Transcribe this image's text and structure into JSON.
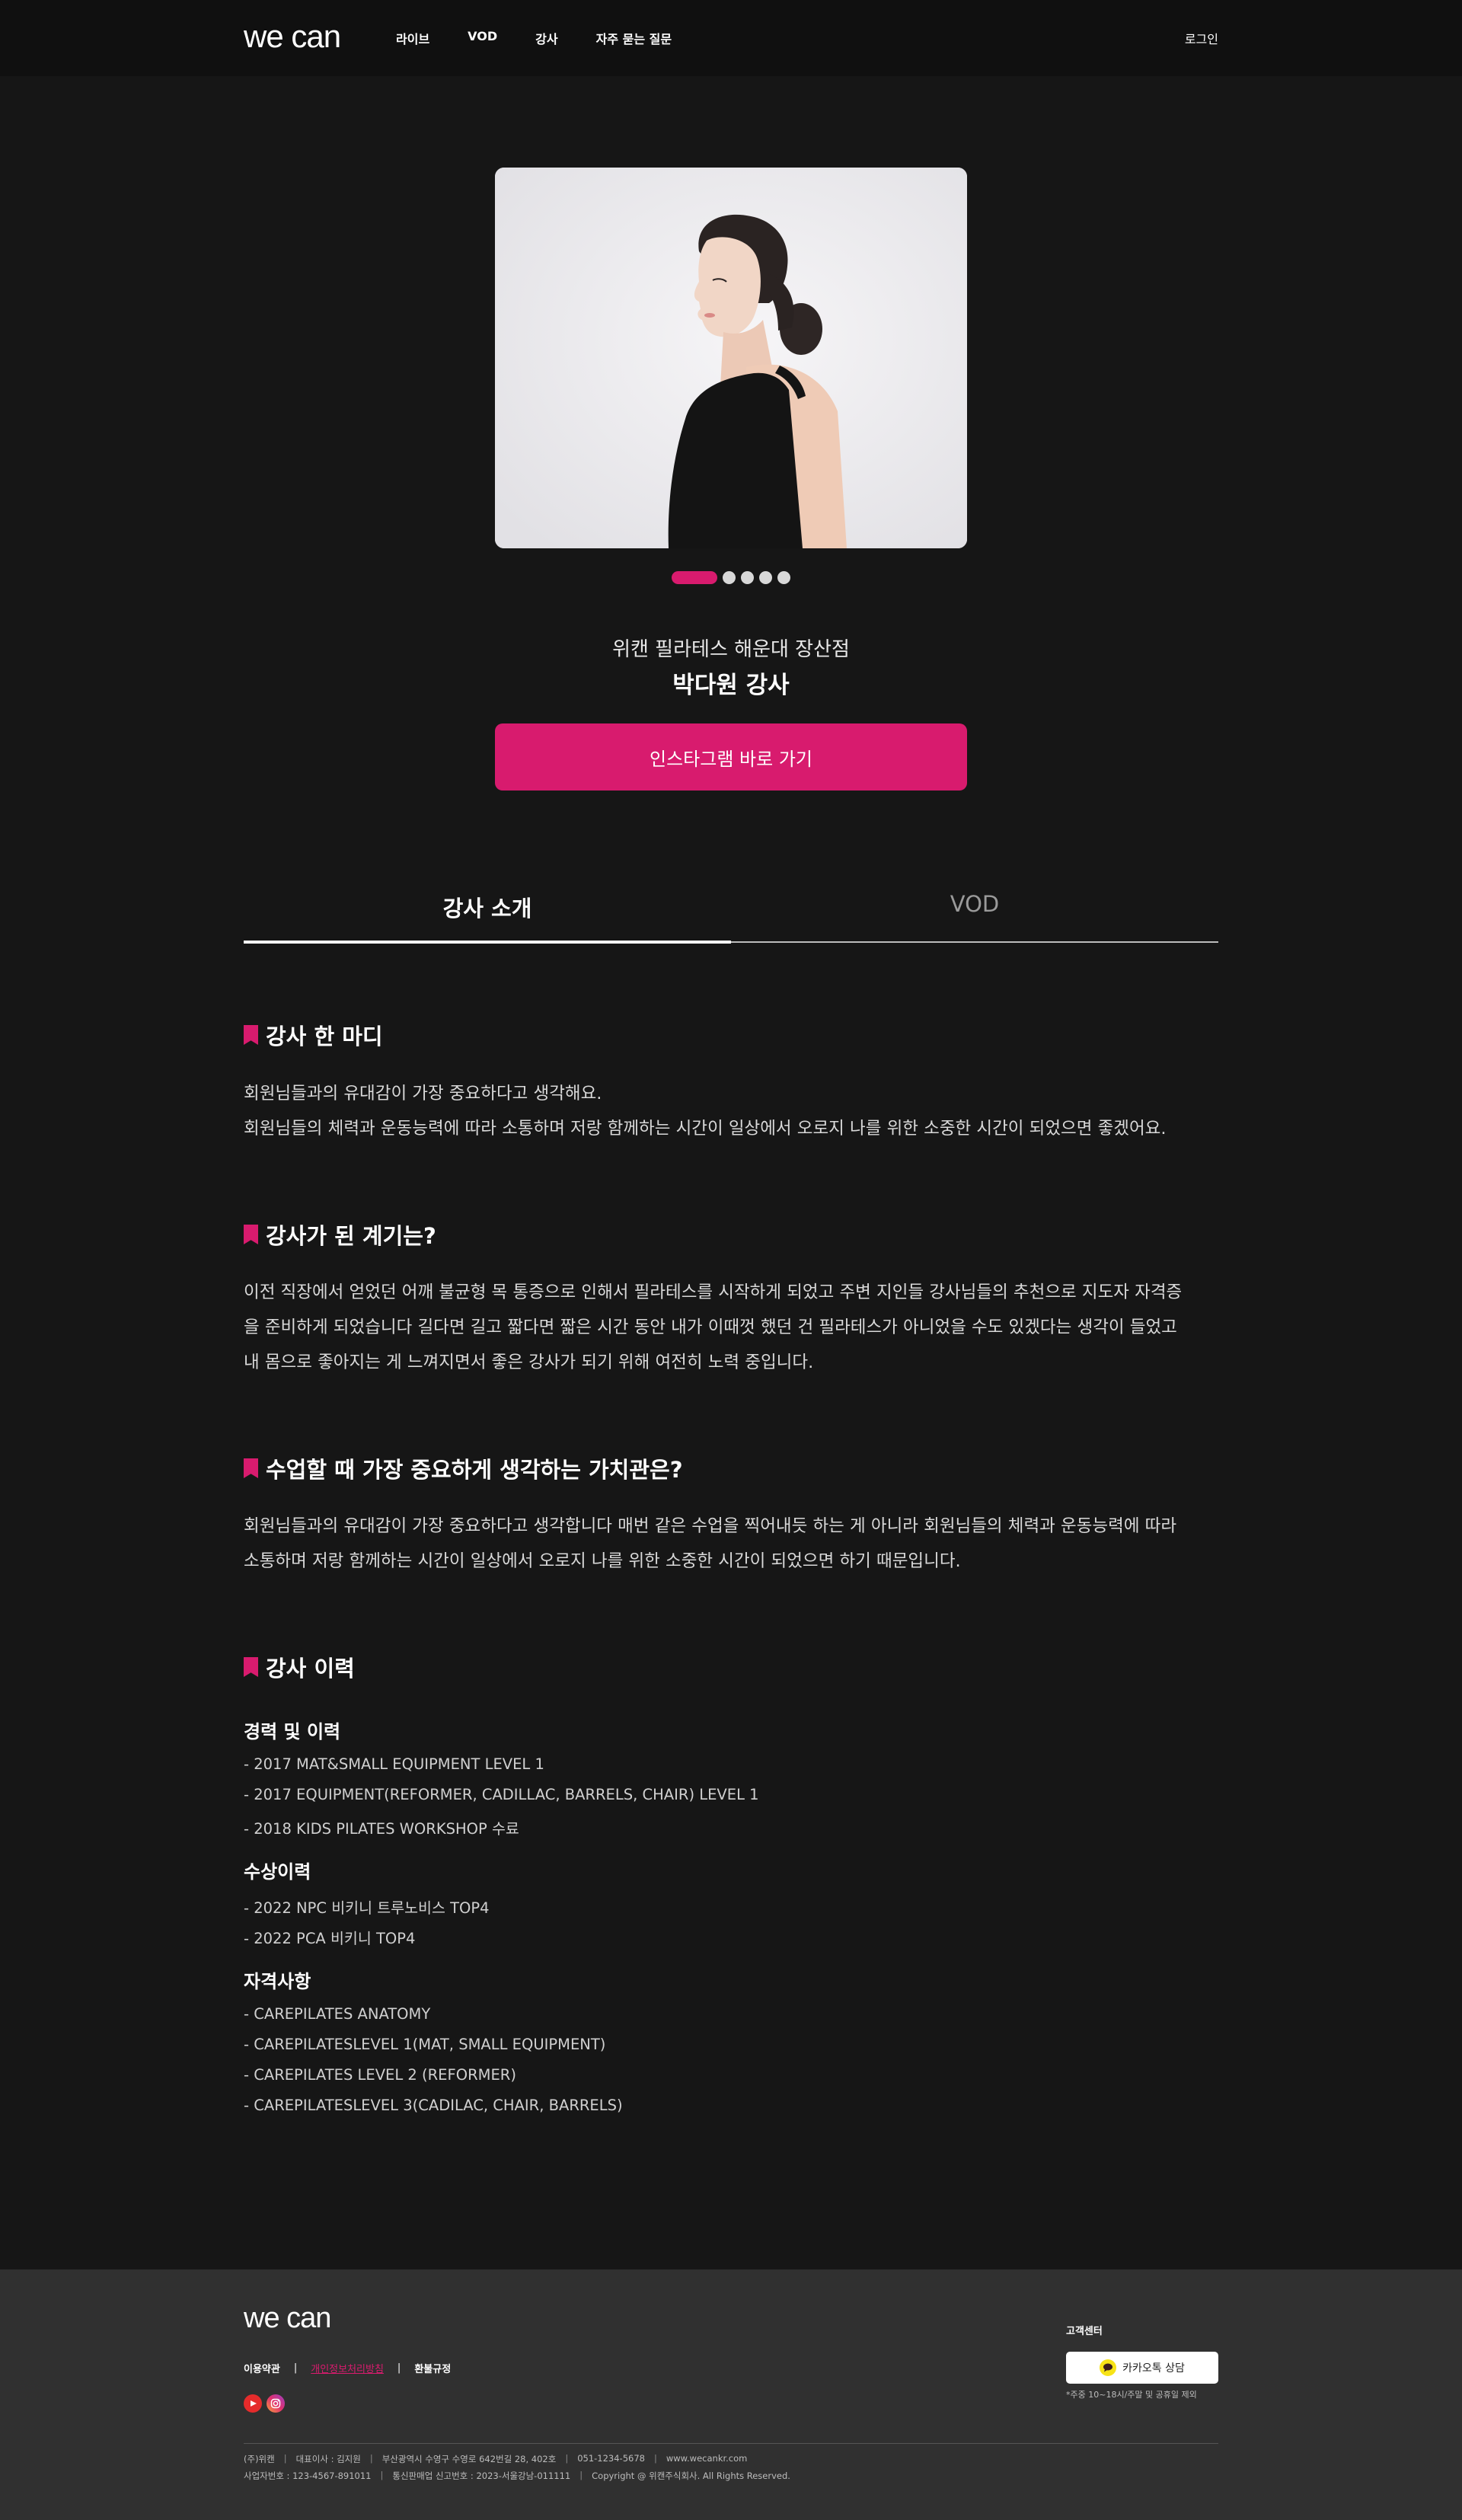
{
  "header": {
    "logo": "we can",
    "nav": [
      "라이브",
      "VOD",
      "강사",
      "자주 묻는 질문"
    ],
    "login": "로그인"
  },
  "profile": {
    "slides_total": 5,
    "active_slide": 1,
    "studio": "위캔 필라테스 해운대 장산점",
    "instructor": "박다원 강사",
    "instagram_button": "인스타그램 바로 가기"
  },
  "tabs": [
    "강사 소개",
    "VOD"
  ],
  "sections": {
    "one_word": {
      "title": "강사 한 마디",
      "lines": [
        "회원님들과의 유대감이 가장 중요하다고 생각해요.",
        "회원님들의 체력과 운동능력에 따라 소통하며 저랑 함께하는 시간이 일상에서 오로지 나를 위한 소중한 시간이 되었으면 좋겠어요."
      ]
    },
    "motivation": {
      "title": "강사가 된 계기는?",
      "lines": [
        "이전 직장에서 얻었던 어깨 불균형 목 통증으로 인해서 필라테스를 시작하게 되었고 주변 지인들 강사님들의 추천으로 지도자 자격증",
        "을 준비하게 되었습니다 길다면 길고 짧다면 짧은 시간 동안 내가 이때껏 했던 건 필라테스가 아니었을 수도 있겠다는 생각이 들었고",
        "내 몸으로 좋아지는 게 느껴지면서 좋은 강사가 되기 위해 여전히 노력 중입니다."
      ]
    },
    "values": {
      "title": "수업할 때 가장 중요하게 생각하는 가치관은?",
      "lines": [
        "회원님들과의 유대감이 가장 중요하다고 생각합니다 매번 같은 수업을 찍어내듯 하는 게 아니라 회원님들의 체력과 운동능력에 따라",
        "소통하며 저랑 함께하는 시간이 일상에서 오로지 나를 위한 소중한 시간이 되었으면 하기 때문입니다."
      ]
    },
    "history": {
      "title": "강사 이력",
      "career_title": "경력 및 이력",
      "career": [
        "- 2017 MAT&SMALL EQUIPMENT LEVEL 1",
        "- 2017 EQUIPMENT(REFORMER, CADILLAC, BARRELS, CHAIR) LEVEL 1",
        "- 2018 KIDS PILATES WORKSHOP 수료"
      ],
      "awards_title": "수상이력",
      "awards": [
        "- 2022 NPC 비키니 트루노비스 TOP4",
        "- 2022 PCA 비키니 TOP4"
      ],
      "certs_title": "자격사항",
      "certs": [
        "- CAREPILATES ANATOMY",
        "- CAREPILATESLEVEL 1(MAT, SMALL EQUIPMENT)",
        "- CAREPILATES LEVEL 2 (REFORMER)",
        "- CAREPILATESLEVEL 3(CADILAC, CHAIR, BARRELS)"
      ]
    }
  },
  "footer": {
    "logo": "we can",
    "links": [
      "이용약관",
      "개인정보처리방침",
      "환불규정"
    ],
    "cs_title": "고객센터",
    "kakao_button": "카카오톡 상담",
    "cs_note": "*주중 10~18시/주말 및 공휴일 제외",
    "info1": [
      "(주)위캔",
      "대표이사 : 김지원",
      "부산광역시 수영구 수영로 642번길 28, 402호",
      "051-1234-5678",
      "www.wecankr.com"
    ],
    "info2": [
      "사업자번호 : 123-4567-891011",
      "통신판매업 신고번호 : 2023-서울강남-011111",
      "Copyright @ 위캔주식회사. All Rights Reserved."
    ]
  },
  "colors": {
    "accent": "#d81b6e",
    "background": "#161616",
    "header": "#101010",
    "footer": "#303030"
  },
  "icons": [
    "youtube-icon",
    "instagram-icon",
    "kakaotalk-icon"
  ]
}
